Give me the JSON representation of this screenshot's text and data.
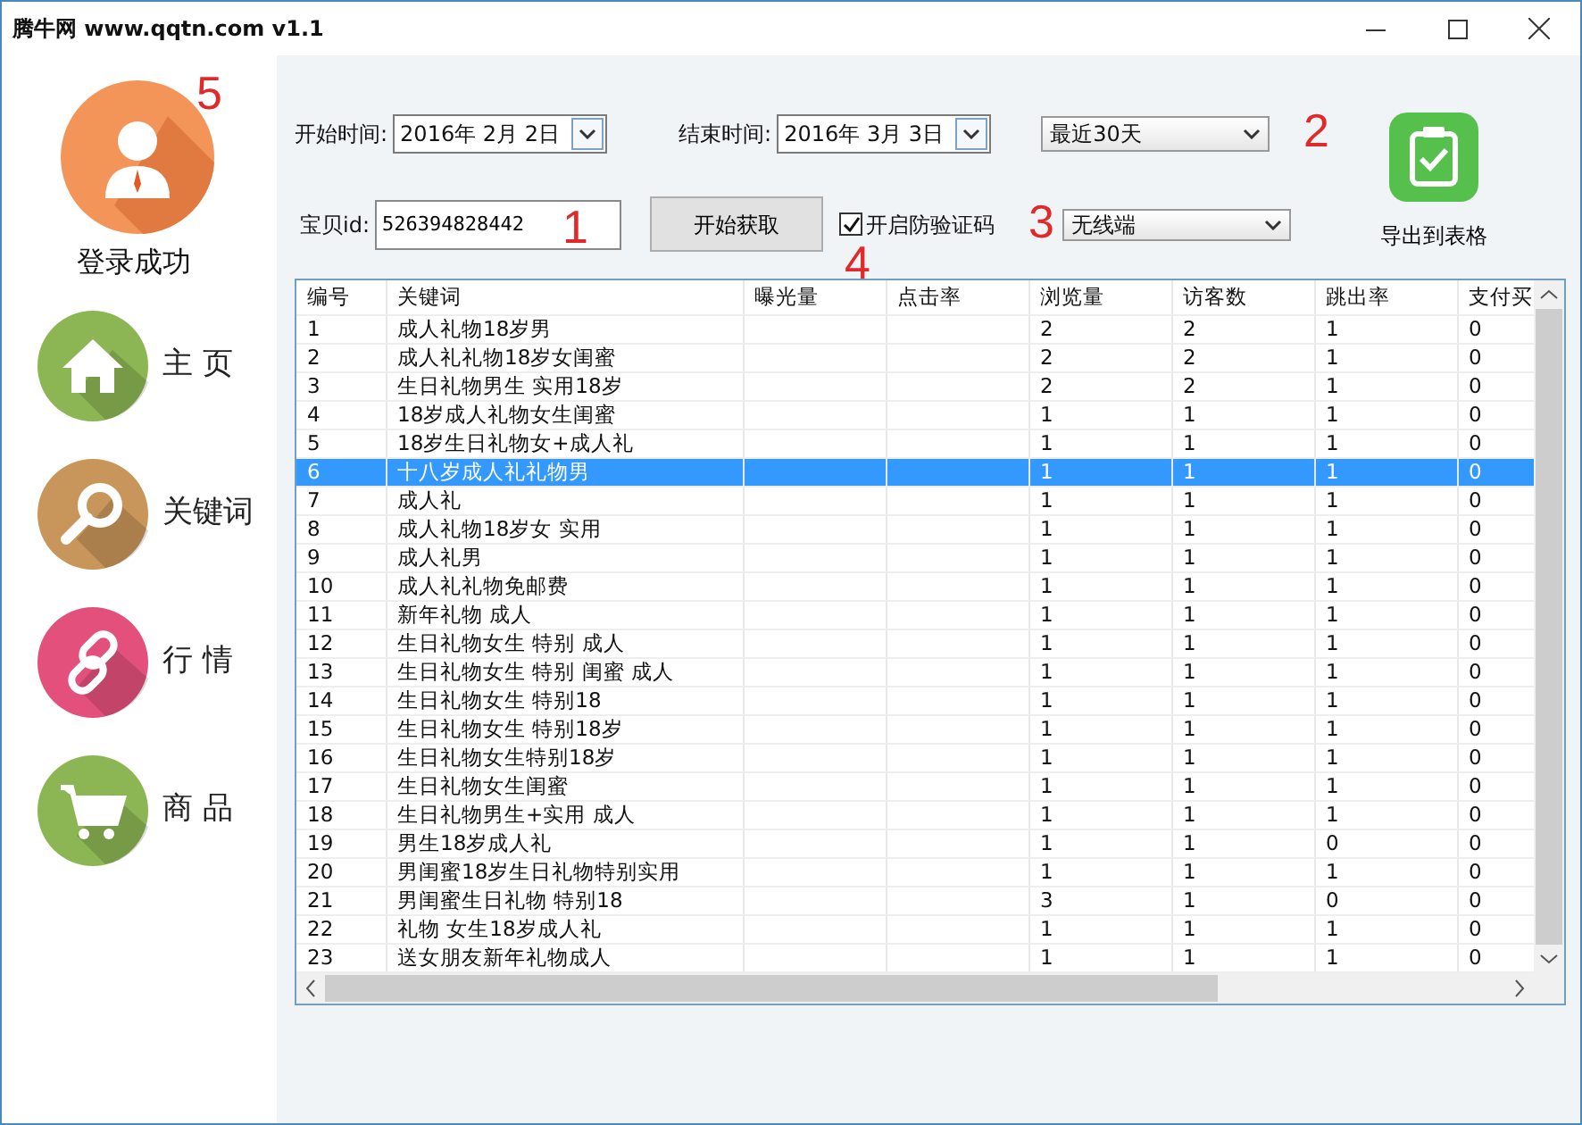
{
  "window": {
    "title": "腾牛网 www.qqtn.com  v1.1"
  },
  "sidebar": {
    "user": {
      "status": "登录成功"
    },
    "items": [
      {
        "label": "主 页",
        "kind": "home",
        "color": "#8cb554"
      },
      {
        "label": "关键词",
        "kind": "search",
        "color": "#c8965a"
      },
      {
        "label": "行 情",
        "kind": "link",
        "color": "#e4507c"
      },
      {
        "label": "商 品",
        "kind": "cart",
        "color": "#8cb554"
      }
    ]
  },
  "controls": {
    "start_label": "开始时间:",
    "start_date": "2016年 2月 2日",
    "end_label": "结束时间:",
    "end_date": "2016年 3月 3日",
    "range": "最近30天",
    "id_label": "宝贝id:",
    "id_value": "526394828442",
    "fetch_button": "开始获取",
    "captcha": {
      "label": "开启防验证码",
      "checked": true
    },
    "platform": "无线端",
    "export_label": "导出到表格"
  },
  "annotations": [
    "5",
    "2",
    "1",
    "3",
    "4"
  ],
  "table": {
    "columns": [
      "编号",
      "关键词",
      "曝光量",
      "点击率",
      "浏览量",
      "访客数",
      "跳出率",
      "支付买"
    ],
    "rows": [
      {
        "cells": [
          "1",
          "成人礼物18岁男",
          "",
          "",
          "2",
          "2",
          "1",
          "0"
        ],
        "selected": false
      },
      {
        "cells": [
          "2",
          "成人礼礼物18岁女闺蜜",
          "",
          "",
          "2",
          "2",
          "1",
          "0"
        ],
        "selected": false
      },
      {
        "cells": [
          "3",
          "生日礼物男生 实用18岁",
          "",
          "",
          "2",
          "2",
          "1",
          "0"
        ],
        "selected": false
      },
      {
        "cells": [
          "4",
          "18岁成人礼物女生闺蜜",
          "",
          "",
          "1",
          "1",
          "1",
          "0"
        ],
        "selected": false
      },
      {
        "cells": [
          "5",
          "18岁生日礼物女+成人礼",
          "",
          "",
          "1",
          "1",
          "1",
          "0"
        ],
        "selected": false
      },
      {
        "cells": [
          "6",
          "十八岁成人礼礼物男",
          "",
          "",
          "1",
          "1",
          "1",
          "0"
        ],
        "selected": true
      },
      {
        "cells": [
          "7",
          "成人礼",
          "",
          "",
          "1",
          "1",
          "1",
          "0"
        ],
        "selected": false
      },
      {
        "cells": [
          "8",
          "成人礼物18岁女 实用",
          "",
          "",
          "1",
          "1",
          "1",
          "0"
        ],
        "selected": false
      },
      {
        "cells": [
          "9",
          "成人礼男",
          "",
          "",
          "1",
          "1",
          "1",
          "0"
        ],
        "selected": false
      },
      {
        "cells": [
          "10",
          "成人礼礼物免邮费",
          "",
          "",
          "1",
          "1",
          "1",
          "0"
        ],
        "selected": false
      },
      {
        "cells": [
          "11",
          "新年礼物 成人",
          "",
          "",
          "1",
          "1",
          "1",
          "0"
        ],
        "selected": false
      },
      {
        "cells": [
          "12",
          "生日礼物女生 特别 成人",
          "",
          "",
          "1",
          "1",
          "1",
          "0"
        ],
        "selected": false
      },
      {
        "cells": [
          "13",
          "生日礼物女生 特别 闺蜜 成人",
          "",
          "",
          "1",
          "1",
          "1",
          "0"
        ],
        "selected": false
      },
      {
        "cells": [
          "14",
          "生日礼物女生 特别18",
          "",
          "",
          "1",
          "1",
          "1",
          "0"
        ],
        "selected": false
      },
      {
        "cells": [
          "15",
          "生日礼物女生 特别18岁",
          "",
          "",
          "1",
          "1",
          "1",
          "0"
        ],
        "selected": false
      },
      {
        "cells": [
          "16",
          "生日礼物女生特别18岁",
          "",
          "",
          "1",
          "1",
          "1",
          "0"
        ],
        "selected": false
      },
      {
        "cells": [
          "17",
          "生日礼物女生闺蜜",
          "",
          "",
          "1",
          "1",
          "1",
          "0"
        ],
        "selected": false
      },
      {
        "cells": [
          "18",
          "生日礼物男生+实用 成人",
          "",
          "",
          "1",
          "1",
          "1",
          "0"
        ],
        "selected": false
      },
      {
        "cells": [
          "19",
          "男生18岁成人礼",
          "",
          "",
          "1",
          "1",
          "0",
          "0"
        ],
        "selected": false
      },
      {
        "cells": [
          "20",
          "男闺蜜18岁生日礼物特别实用",
          "",
          "",
          "1",
          "1",
          "1",
          "0"
        ],
        "selected": false
      },
      {
        "cells": [
          "21",
          "男闺蜜生日礼物 特别18",
          "",
          "",
          "3",
          "1",
          "0",
          "0"
        ],
        "selected": false
      },
      {
        "cells": [
          "22",
          "礼物 女生18岁成人礼",
          "",
          "",
          "1",
          "1",
          "1",
          "0"
        ],
        "selected": false
      },
      {
        "cells": [
          "23",
          "送女朋友新年礼物成人",
          "",
          "",
          "1",
          "1",
          "1",
          "0"
        ],
        "selected": false
      }
    ]
  }
}
